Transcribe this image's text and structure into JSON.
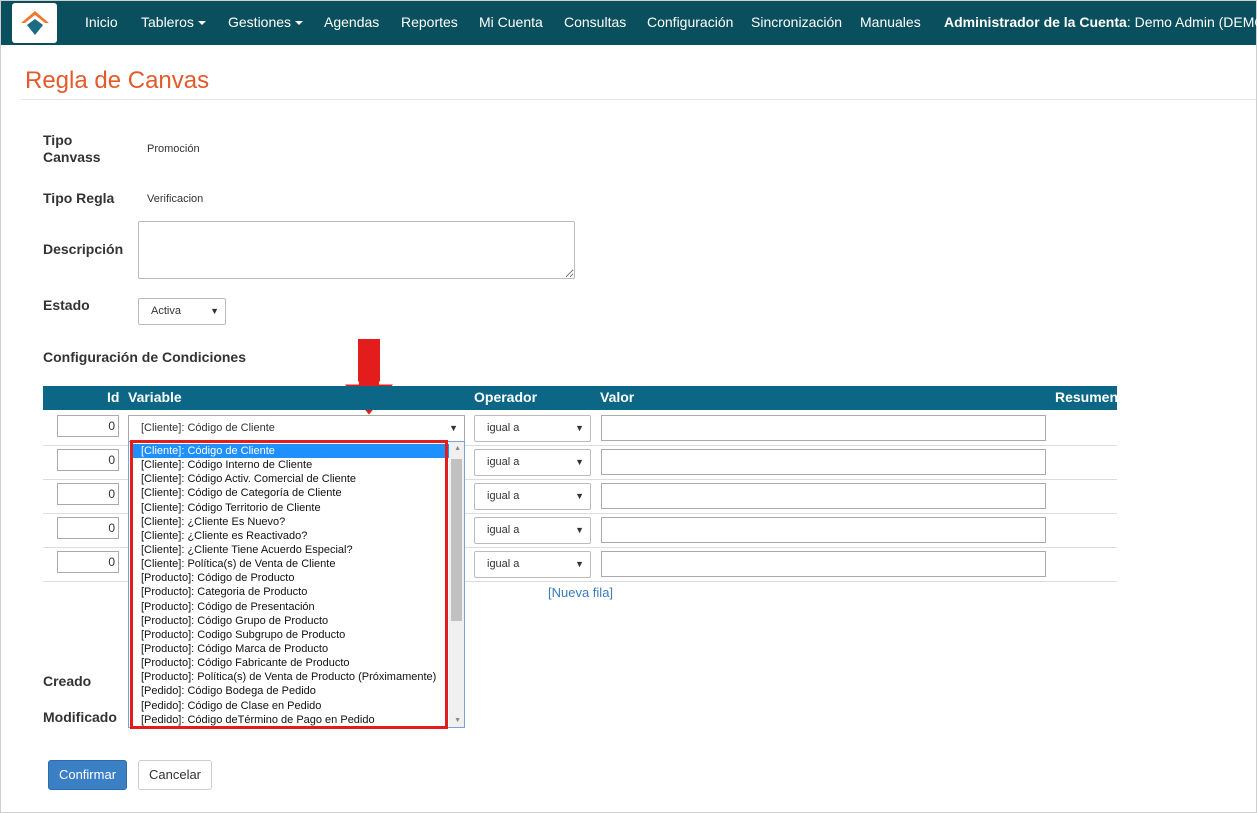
{
  "nav": {
    "items": [
      "Inicio",
      "Tableros",
      "Gestiones",
      "Agendas",
      "Reportes",
      "Mi Cuenta",
      "Consultas",
      "Configuración",
      "Sincronización",
      "Manuales"
    ],
    "account_label": "Administrador de la Cuenta",
    "account_user": ": Demo Admin (DEMO)"
  },
  "page": {
    "title": "Regla de Canvas"
  },
  "form": {
    "tipo_canvass_label_1": "Tipo",
    "tipo_canvass_label_2": "Canvass",
    "tipo_canvass_value": "Promoción",
    "tipo_regla_label": "Tipo Regla",
    "tipo_regla_value": "Verificacion",
    "descripcion_label": "Descripción",
    "descripcion_value": "",
    "estado_label": "Estado",
    "estado_value": "Activa",
    "config_label": "Configuración de Condiciones",
    "creado_label": "Creado",
    "modificado_label": "Modificado"
  },
  "table": {
    "headers": {
      "id": "Id",
      "variable": "Variable",
      "operador": "Operador",
      "valor": "Valor",
      "resumen": "Resumen"
    },
    "rows": [
      {
        "id": "0",
        "operador": "igual a"
      },
      {
        "id": "0",
        "operador": "igual a"
      },
      {
        "id": "0",
        "operador": "igual a"
      },
      {
        "id": "0",
        "operador": "igual a"
      },
      {
        "id": "0",
        "operador": "igual a"
      }
    ],
    "variable_selected": "[Cliente]: Código de Cliente",
    "new_row_link": "[Nueva fila]"
  },
  "dropdown": {
    "options": [
      "[Cliente]: Código de Cliente",
      "[Cliente]: Código Interno de Cliente",
      "[Cliente]: Código Activ. Comercial de Cliente",
      "[Cliente]: Código de Categoría de Cliente",
      "[Cliente]: Código Territorio de Cliente",
      "[Cliente]: ¿Cliente Es Nuevo?",
      "[Cliente]: ¿Cliente es Reactivado?",
      "[Cliente]: ¿Cliente Tiene Acuerdo Especial?",
      "[Cliente]: Política(s) de Venta de Cliente",
      "[Producto]: Código de Producto",
      "[Producto]: Categoria de Producto",
      "[Producto]: Código de Presentación",
      "[Producto]: Código Grupo de Producto",
      "[Producto]: Codigo Subgrupo de Producto",
      "[Producto]: Código Marca de Producto",
      "[Producto]: Código Fabricante de Producto",
      "[Producto]: Política(s) de Venta de Producto (Próximamente)",
      "[Pedido]: Código Bodega de Pedido",
      "[Pedido]: Código de Clase en Pedido",
      "[Pedido]: Código deTérmino de Pago en Pedido"
    ]
  },
  "buttons": {
    "confirm": "Confirmar",
    "cancel": "Cancelar"
  },
  "colors": {
    "navbar": "#0a4f5e",
    "table_header": "#0b6785",
    "title": "#e35a2b",
    "annotation": "#e31c1c",
    "primary": "#3b7fc4"
  }
}
